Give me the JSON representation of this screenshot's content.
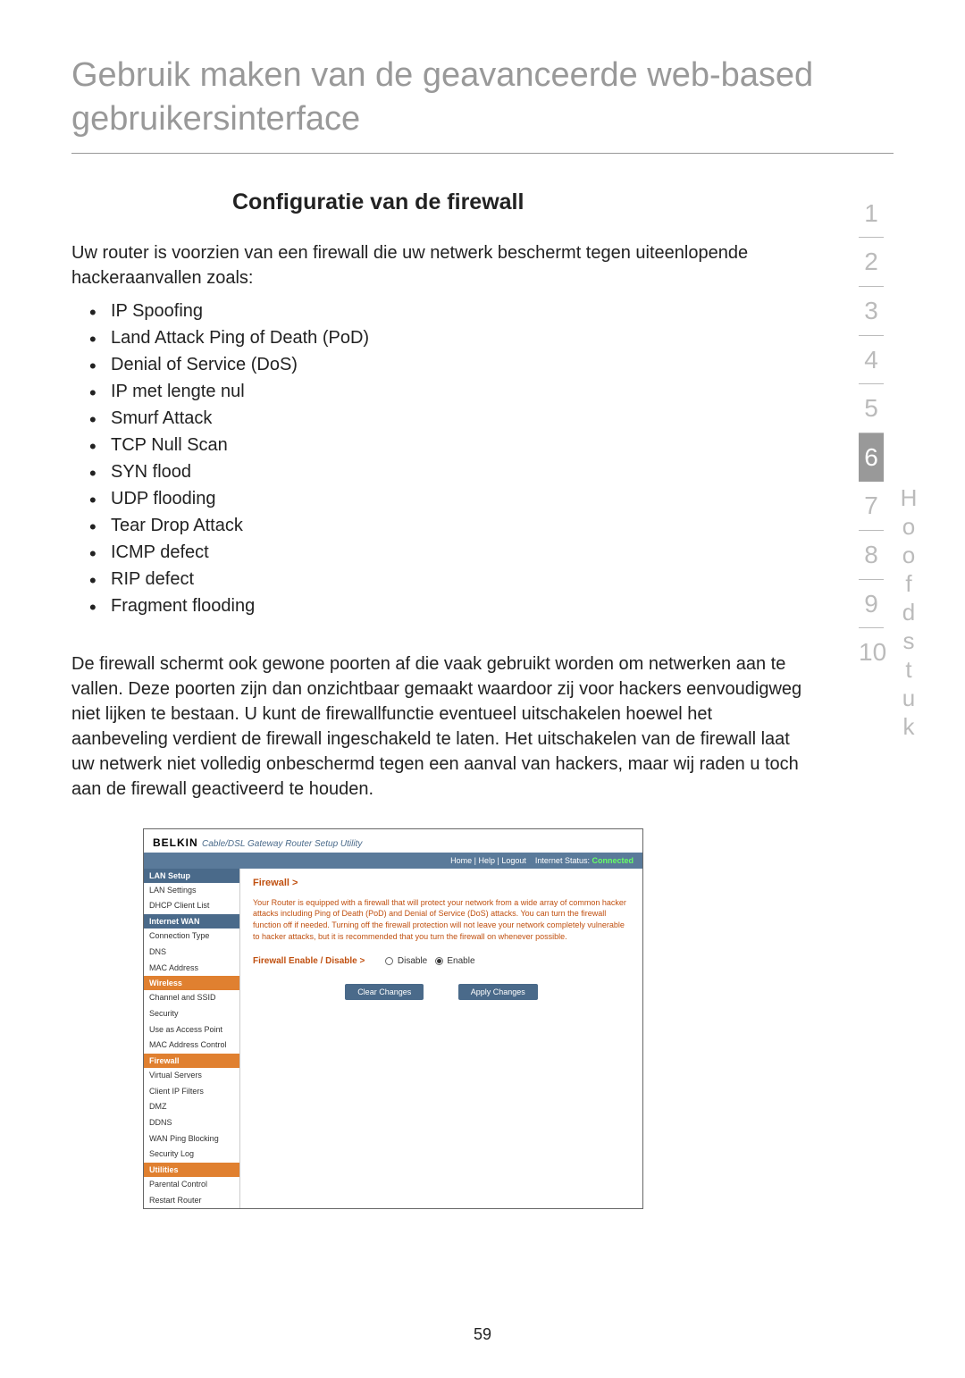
{
  "page_title": "Gebruik maken van de geavanceerde web-based gebruikersinterface",
  "section_heading": "Configuratie van de firewall",
  "intro_text": "Uw router is voorzien van een firewall die uw netwerk beschermt tegen uiteenlopende hackeraanvallen zoals:",
  "attacks": [
    "IP Spoofing",
    "Land Attack Ping of Death (PoD)",
    "Denial of Service (DoS)",
    "IP met lengte nul",
    "Smurf Attack",
    "TCP Null Scan",
    "SYN flood",
    "UDP flooding",
    "Tear Drop Attack",
    "ICMP defect",
    "RIP defect",
    "Fragment flooding"
  ],
  "body_text": "De firewall schermt ook gewone poorten af die vaak gebruikt worden om netwerken aan te vallen. Deze poorten zijn dan onzichtbaar gemaakt waardoor zij voor hackers eenvoudigweg niet lijken te bestaan. U kunt de firewallfunctie eventueel uitschakelen hoewel het aanbeveling verdient de firewall ingeschakeld te laten. Het uitschakelen van de firewall laat uw netwerk niet volledig onbeschermd tegen een aanval van hackers, maar wij raden u toch aan de firewall geactiveerd te houden.",
  "chapters": [
    "1",
    "2",
    "3",
    "4",
    "5",
    "6",
    "7",
    "8",
    "9",
    "10"
  ],
  "active_chapter": "6",
  "vertical_label": "Hoofdstuk",
  "page_number": "59",
  "screenshot": {
    "brand": "BELKIN",
    "brand_sub": "Cable/DSL Gateway Router Setup Utility",
    "topbar": {
      "links": "Home | Help | Logout",
      "status_label": "Internet Status:",
      "status_value": "Connected"
    },
    "sidebar": {
      "groups": [
        {
          "head": "LAN Setup",
          "class": "",
          "items": [
            "LAN Settings",
            "DHCP Client List"
          ]
        },
        {
          "head": "Internet WAN",
          "class": "",
          "items": [
            "Connection Type",
            "DNS",
            "MAC Address"
          ]
        },
        {
          "head": "Wireless",
          "class": "orange",
          "items": [
            "Channel and SSID",
            "Security",
            "Use as Access Point",
            "MAC Address Control"
          ]
        },
        {
          "head": "Firewall",
          "class": "orange",
          "items": [
            "Virtual Servers",
            "Client IP Filters",
            "DMZ",
            "DDNS",
            "WAN Ping Blocking",
            "Security Log"
          ]
        },
        {
          "head": "Utilities",
          "class": "orange",
          "items": [
            "Parental Control",
            "Restart Router"
          ]
        }
      ]
    },
    "main": {
      "breadcrumb": "Firewall >",
      "description": "Your Router is equipped with a firewall that will protect your network from a wide array of common hacker attacks including Ping of Death (PoD) and Denial of Service (DoS) attacks. You can turn the firewall function off if needed. Turning off the firewall protection will not leave your network completely vulnerable to hacker attacks, but it is recommended that you turn the firewall on whenever possible.",
      "option_label": "Firewall Enable / Disable >",
      "option_disable": "Disable",
      "option_enable": "Enable",
      "btn_clear": "Clear Changes",
      "btn_apply": "Apply Changes"
    }
  }
}
